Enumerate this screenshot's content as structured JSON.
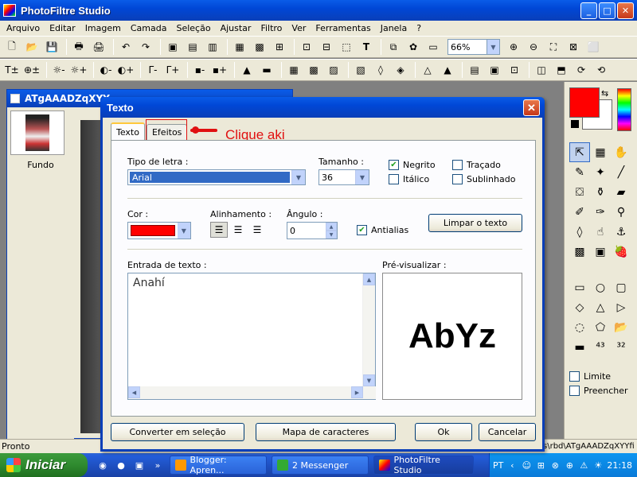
{
  "app": {
    "title": "PhotoFiltre Studio",
    "window_buttons": [
      "_",
      "□",
      "✕"
    ]
  },
  "menu": [
    "Arquivo",
    "Editar",
    "Imagem",
    "Camada",
    "Seleção",
    "Ajustar",
    "Filtro",
    "Ver",
    "Ferramentas",
    "Janela",
    "?"
  ],
  "toolbar": {
    "zoom": "66%"
  },
  "document": {
    "title": "ATgAAADZqXYY",
    "layer_label": "Fundo"
  },
  "palette": {
    "fg_color": "#ff0000",
    "bg_color": "#ffffff",
    "limite_label": "Limite",
    "preencher_label": "Preencher"
  },
  "status": {
    "text": "Pronto",
    "path": "s\\rbd\\ATgAAADZqXYYfi"
  },
  "taskbar": {
    "start_label": "Iniciar",
    "tasks": [
      "Blogger: Apren...",
      "2 Messenger",
      "PhotoFiltre Studio"
    ],
    "lang": "PT",
    "clock": "21:18"
  },
  "dialog": {
    "title": "Texto",
    "tabs": [
      "Texto",
      "Efeitos"
    ],
    "annotation": "Clique aki",
    "annotation2": "<-",
    "font_label": "Tipo de letra :",
    "font_value": "Arial",
    "size_label": "Tamanho :",
    "size_value": "36",
    "bold_label": "Negrito",
    "italic_label": "Itálico",
    "strike_label": "Traçado",
    "underline_label": "Sublinhado",
    "bold_checked": true,
    "italic_checked": false,
    "strike_checked": false,
    "underline_checked": false,
    "color_label": "Cor :",
    "text_color": "#ff0000",
    "align_label": "Alinhamento :",
    "angle_label": "Ângulo :",
    "angle_value": "0",
    "antialias_label": "Antialias",
    "antialias_checked": true,
    "clear_button": "Limpar o texto",
    "input_label": "Entrada de texto :",
    "input_value": "Anahí",
    "preview_label": "Pré-visualizar :",
    "preview_text": "AbYz",
    "convert_button": "Converter em seleção",
    "charmap_button": "Mapa de caracteres",
    "ok_button": "Ok",
    "cancel_button": "Cancelar"
  }
}
